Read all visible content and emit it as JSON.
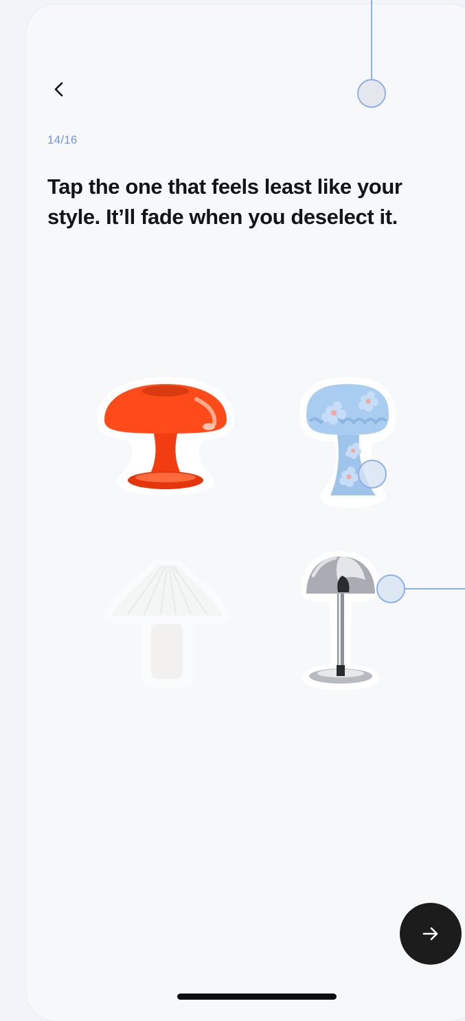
{
  "header": {
    "back_icon": "chevron-left-icon",
    "progress": "14/16"
  },
  "prompt": {
    "text": "Tap the one that feels least like your style. It’ll fade when you deselect it."
  },
  "options": [
    {
      "id": "orange-mushroom-lamp",
      "selected": true,
      "color": "#ff4a1a"
    },
    {
      "id": "blue-fluffy-flower-lamp",
      "selected": true,
      "color": "#9fc4ec"
    },
    {
      "id": "white-pleated-lamp",
      "selected": false,
      "color": "#ffffff"
    },
    {
      "id": "chrome-dome-lamp",
      "selected": true,
      "color": "#b8bcc2"
    }
  ],
  "footer": {
    "next_icon": "arrow-right-icon"
  },
  "colors": {
    "accent": "#6f95e0",
    "text": "#141414",
    "button": "#1c1c1c",
    "background": "#f7f8fa"
  }
}
